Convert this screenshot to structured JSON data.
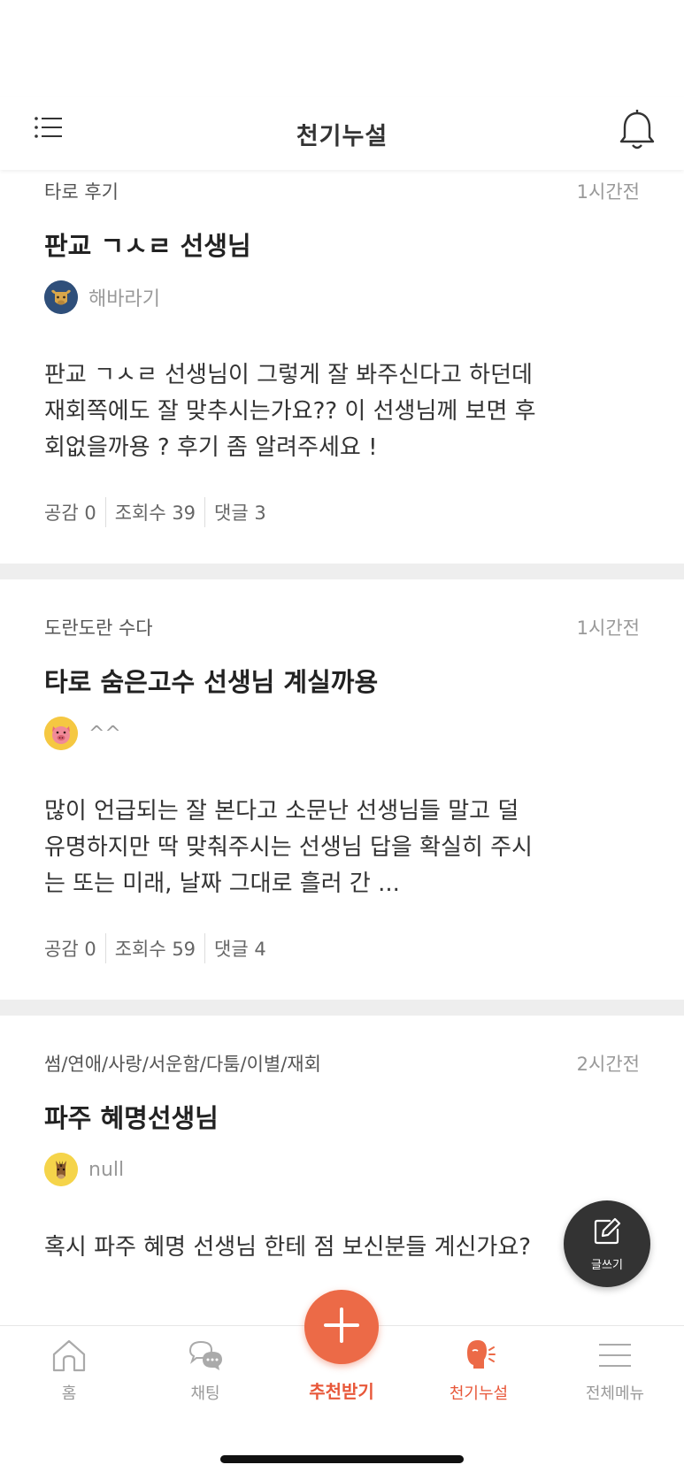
{
  "header": {
    "title": "천기누설"
  },
  "posts": [
    {
      "category": "타로 후기",
      "time": "1시간전",
      "title": "판교 ㄱㅅㄹ 선생님",
      "author": "해바라기",
      "avatar_icon": "ox-avatar-icon",
      "body": "판교 ㄱㅅㄹ 선생님이 그렇게 잘 봐주신다고 하던데 재회쪽에도 잘 맞추시는가요?? 이 선생님께 보면 후회없을까용 ? 후기 좀 알려주세요 !",
      "stats": {
        "likes": "공감 0",
        "views": "조회수 39",
        "comments": "댓글 3"
      }
    },
    {
      "category": "도란도란 수다",
      "time": "1시간전",
      "title": "타로 숨은고수 선생님 계실까용",
      "author": "^^",
      "avatar_icon": "pig-avatar-icon",
      "body": "많이 언급되는 잘 본다고 소문난 선생님들 말고 덜 유명하지만 딱 맞춰주시는 선생님 답을 확실히 주시는 또는 미래, 날짜 그대로 흘러 간 ...",
      "stats": {
        "likes": "공감 0",
        "views": "조회수 59",
        "comments": "댓글 4"
      }
    },
    {
      "category": "썸/연애/사랑/서운함/다툼/이별/재회",
      "time": "2시간전",
      "title": "파주 혜명선생님",
      "author": "null",
      "avatar_icon": "horse-avatar-icon",
      "body": "혹시 파주 혜명 선생님 한테 점 보신분들 계신가요?"
    }
  ],
  "fab": {
    "label": "글쓰기"
  },
  "tabbar": {
    "home": "홈",
    "chat": "채팅",
    "recommend": "추천받기",
    "secret": "천기누설",
    "menu": "전체메뉴"
  },
  "colors": {
    "accent": "#ec6a47",
    "active_text": "#e8583a",
    "fab_bg": "#333333",
    "divider": "#eeeeee"
  }
}
